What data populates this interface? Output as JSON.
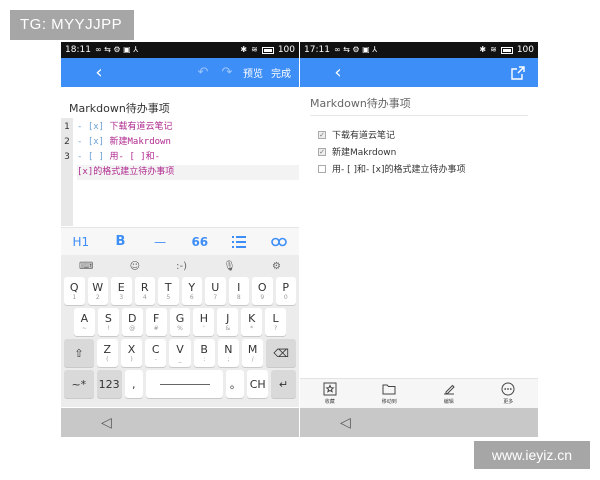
{
  "watermarks": {
    "top_left": "TG: MYYJJPP",
    "bottom_right": "www.ieyiz.cn"
  },
  "left_phone": {
    "status": {
      "time": "18:11",
      "left_icons": "∞ ⇆ ⚙ ▣ ⅄",
      "battery": "100"
    },
    "appbar": {
      "preview_label": "预览",
      "done_label": "完成"
    },
    "doc_title": "Markdown待办事项",
    "editor": {
      "line_numbers": [
        "1",
        "2",
        "3"
      ],
      "lines": [
        {
          "mark": "- [x] ",
          "text": "下载有道云笔记"
        },
        {
          "mark": "- [x] ",
          "text": "新建Makrdown"
        },
        {
          "mark": "- [ ] ",
          "text": "用- [ ]和-"
        },
        {
          "mark": "",
          "text": "[x]的格式建立待办事项"
        }
      ]
    },
    "format_toolbar": {
      "heading": "H1",
      "bold": "B",
      "rule": "—",
      "quote": "66"
    },
    "keyboard": {
      "top_icons": [
        "keyboard-icon",
        "emoji-icon",
        "emoticon-icon",
        "mic-icon",
        "settings-icon"
      ],
      "emoticon_label": ":-)",
      "row1": [
        {
          "k": "Q",
          "s": "1"
        },
        {
          "k": "W",
          "s": "2"
        },
        {
          "k": "E",
          "s": "3"
        },
        {
          "k": "R",
          "s": "4"
        },
        {
          "k": "T",
          "s": "5"
        },
        {
          "k": "Y",
          "s": "6"
        },
        {
          "k": "U",
          "s": "7"
        },
        {
          "k": "I",
          "s": "8"
        },
        {
          "k": "O",
          "s": "9"
        },
        {
          "k": "P",
          "s": "0"
        }
      ],
      "row2": [
        {
          "k": "A",
          "s": "~"
        },
        {
          "k": "S",
          "s": "!"
        },
        {
          "k": "D",
          "s": "@"
        },
        {
          "k": "F",
          "s": "#"
        },
        {
          "k": "G",
          "s": "%"
        },
        {
          "k": "H",
          "s": "'"
        },
        {
          "k": "J",
          "s": "&"
        },
        {
          "k": "K",
          "s": "*"
        },
        {
          "k": "L",
          "s": "?"
        }
      ],
      "row3": [
        {
          "k": "Z",
          "s": "("
        },
        {
          "k": "X",
          "s": ")"
        },
        {
          "k": "C",
          "s": "-"
        },
        {
          "k": "V",
          "s": "_"
        },
        {
          "k": "B",
          "s": ":"
        },
        {
          "k": "N",
          "s": ";"
        },
        {
          "k": "M",
          "s": "/"
        }
      ],
      "row4": {
        "symbols": "~*",
        "numbers": "123",
        "comma": ",",
        "period": "。",
        "lang": "CH"
      }
    }
  },
  "right_phone": {
    "status": {
      "time": "17:11",
      "left_icons": "∞ ⇆ ⚙ ▣ ⅄",
      "battery": "100"
    },
    "doc_title": "Markdown待办事项",
    "todos": [
      {
        "text": "下载有道云笔记",
        "checked": true
      },
      {
        "text": "新建Makrdown",
        "checked": true
      },
      {
        "text": "用- [ ]和- [x]的格式建立待办事项",
        "checked": false
      }
    ],
    "bottom_tabs": [
      {
        "label": "收藏",
        "icon": "star-icon"
      },
      {
        "label": "移动到",
        "icon": "folder-icon"
      },
      {
        "label": "编辑",
        "icon": "edit-icon"
      },
      {
        "label": "更多",
        "icon": "more-icon"
      }
    ]
  }
}
